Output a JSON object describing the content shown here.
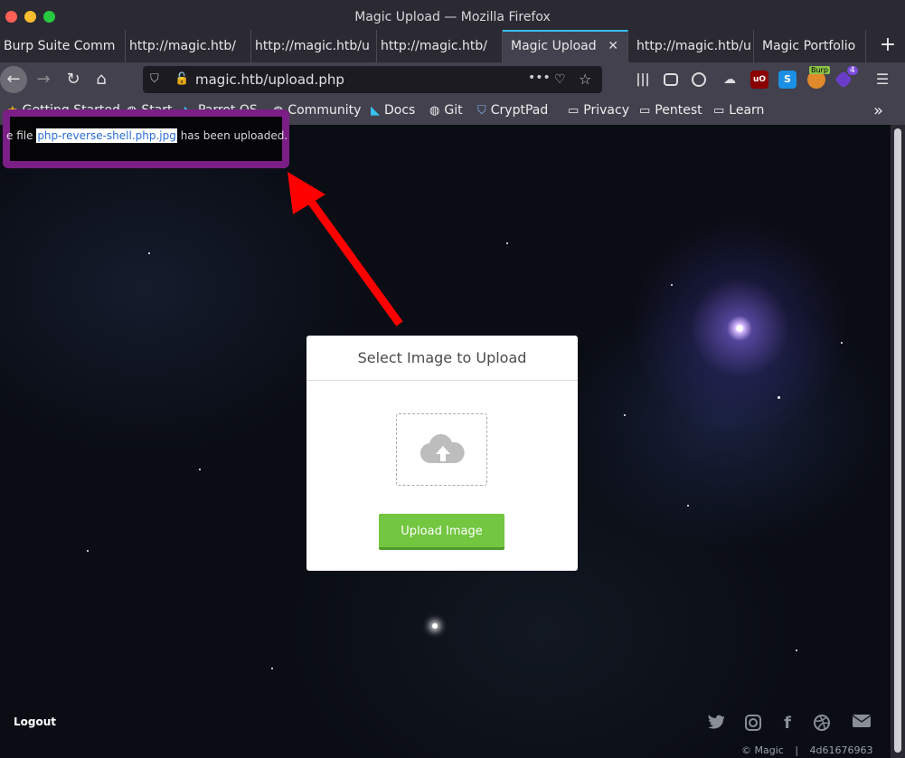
{
  "window": {
    "title": "Magic Upload — Mozilla Firefox"
  },
  "tabs": [
    {
      "label": "Burp Suite Comm",
      "active": false
    },
    {
      "label": "http://magic.htb/",
      "active": false
    },
    {
      "label": "http://magic.htb/u",
      "active": false
    },
    {
      "label": "http://magic.htb/",
      "active": false
    },
    {
      "label": "Magic Upload",
      "active": true
    },
    {
      "label": "http://magic.htb/u",
      "active": false
    },
    {
      "label": "Magic Portfolio",
      "active": false
    }
  ],
  "new_tab_label": "+",
  "url": "magic.htb/upload.php",
  "url_menu_label": "•••",
  "toolbar_badges": {
    "burp": "Burp",
    "count": "4"
  },
  "bookmarks": [
    {
      "label": "Getting Started",
      "icon": "star-icon"
    },
    {
      "label": "Start",
      "icon": "globe-icon"
    },
    {
      "label": "Parrot OS",
      "icon": "parrot-icon"
    },
    {
      "label": "Community",
      "icon": "globe-icon"
    },
    {
      "label": "Docs",
      "icon": "parrot-icon"
    },
    {
      "label": "Git",
      "icon": "globe-icon"
    },
    {
      "label": "CryptPad",
      "icon": "shield-icon"
    },
    {
      "label": "Privacy",
      "icon": "folder-icon"
    },
    {
      "label": "Pentest",
      "icon": "folder-icon"
    },
    {
      "label": "Learn",
      "icon": "folder-icon"
    }
  ],
  "bookmarks_overflow": "»",
  "notice": {
    "prefix": "e file",
    "filename": "php-reverse-shell.php.jpg",
    "suffix": "has been uploaded."
  },
  "upload_card": {
    "title": "Select Image to Upload",
    "button": "Upload Image"
  },
  "logout_label": "Logout",
  "footer": {
    "copyright": "© Magic",
    "separator": "|",
    "hash": "4d61676963"
  },
  "colors": {
    "accent": "#36bff0",
    "annotation_box": "#7b1f86",
    "annotation_arrow": "#ff0000",
    "upload_button": "#72c640"
  }
}
